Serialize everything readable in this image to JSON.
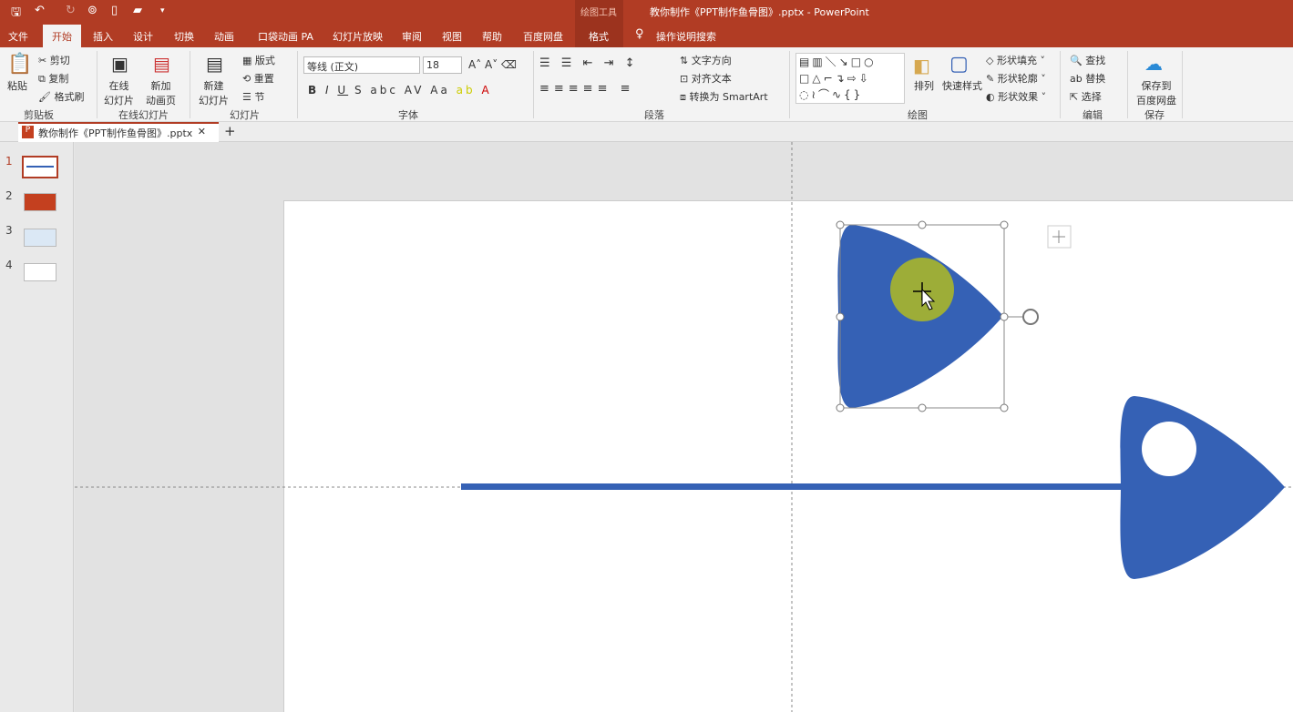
{
  "titlebar": {
    "context_group": "绘图工具",
    "window_title": "教你制作《PPT制作鱼骨图》.pptx  -  PowerPoint"
  },
  "tabs": [
    "文件",
    "开始",
    "插入",
    "设计",
    "切换",
    "动画",
    "口袋动画 PA",
    "幻灯片放映",
    "审阅",
    "视图",
    "帮助",
    "百度网盘",
    "格式"
  ],
  "tell_me": "操作说明搜索",
  "ribbon": {
    "clipboard": {
      "paste": "粘贴",
      "cut": "剪切",
      "copy": "复制",
      "format_painter": "格式刷",
      "label": "剪贴板"
    },
    "online": {
      "online_slides": "在线\n幻灯片",
      "new_anim": "新加\n动画页",
      "label": "在线幻灯片"
    },
    "slides": {
      "new_slide": "新建\n幻灯片",
      "layout": "版式",
      "reset": "重置",
      "section": "节",
      "label": "幻灯片"
    },
    "font": {
      "font_name": "等线 (正文)",
      "font_size": "18",
      "label": "字体"
    },
    "paragraph": {
      "text_direction": "文字方向",
      "align_text": "对齐文本",
      "smartart": "转换为 SmartArt",
      "label": "段落"
    },
    "drawing": {
      "arrange": "排列",
      "quick_styles": "快速样式",
      "shape_fill": "形状填充",
      "shape_outline": "形状轮廓",
      "shape_effects": "形状效果",
      "label": "绘图"
    },
    "editing": {
      "find": "查找",
      "replace": "替换",
      "select": "选择",
      "label": "编辑"
    },
    "save": {
      "save_baidu": "保存到\n百度网盘",
      "label": "保存"
    }
  },
  "document_tab": "教你制作《PPT制作鱼骨图》.pptx",
  "slides": [
    "1",
    "2",
    "3",
    "4"
  ],
  "selected_slide": "1",
  "colors": {
    "accent": "#b13c24",
    "shape_blue": "#3561b5",
    "highlight": "#a9b62a"
  }
}
